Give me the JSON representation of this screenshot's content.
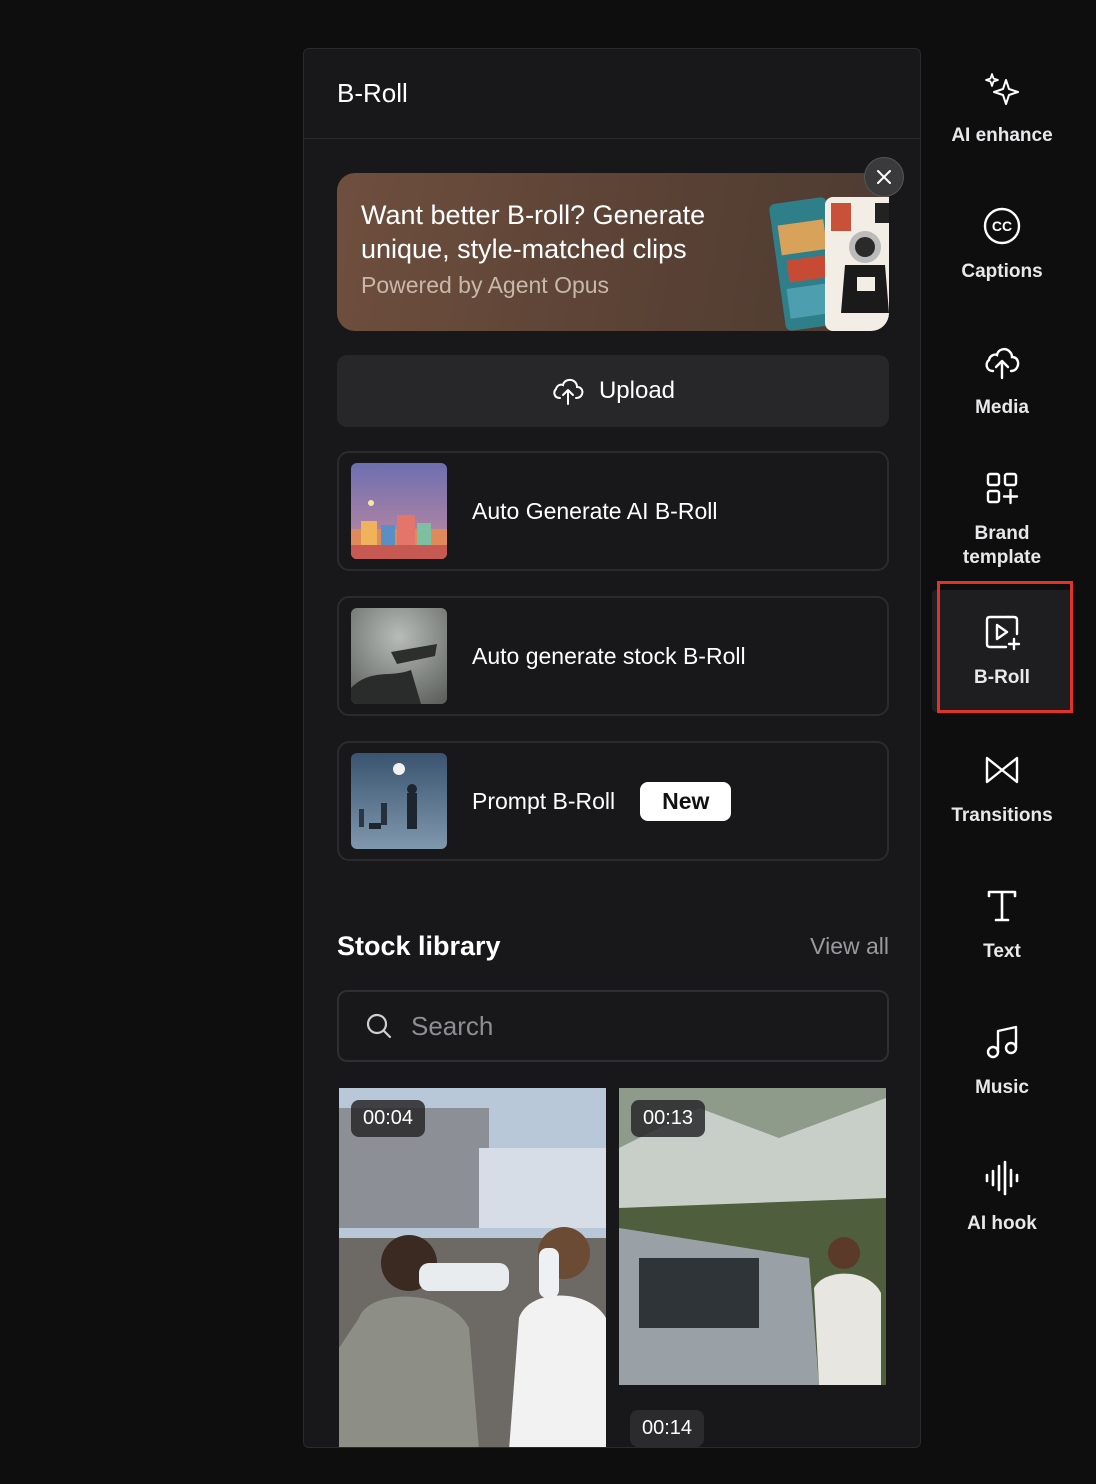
{
  "panel": {
    "title": "B-Roll"
  },
  "promo": {
    "title": "Want better B-roll? Generate unique, style-matched clips",
    "subtitle": "Powered by Agent Opus"
  },
  "upload": {
    "label": "Upload"
  },
  "options": [
    {
      "label": "Auto Generate AI B-Roll"
    },
    {
      "label": "Auto generate stock B-Roll"
    },
    {
      "label": "Prompt B-Roll",
      "badge": "New"
    }
  ],
  "stock": {
    "title": "Stock library",
    "view_all": "View all",
    "search_placeholder": "Search",
    "clips": [
      {
        "duration": "00:04"
      },
      {
        "duration": "00:13"
      },
      {
        "duration": "00:14"
      }
    ]
  },
  "sidebar": {
    "active": "B-Roll",
    "items": [
      {
        "label": "AI enhance",
        "icon": "sparkles-icon"
      },
      {
        "label": "Captions",
        "icon": "cc-icon"
      },
      {
        "label": "Media",
        "icon": "cloud-upload-icon"
      },
      {
        "label": "Brand template",
        "icon": "grid-plus-icon"
      },
      {
        "label": "B-Roll",
        "icon": "video-plus-icon"
      },
      {
        "label": "Transitions",
        "icon": "transition-icon"
      },
      {
        "label": "Text",
        "icon": "text-icon"
      },
      {
        "label": "Music",
        "icon": "music-icon"
      },
      {
        "label": "AI hook",
        "icon": "waveform-icon"
      }
    ]
  },
  "colors": {
    "background": "#0e0e0f",
    "panel": "#18181a",
    "promo": "#6f4f3e",
    "highlight": "#e0332b"
  }
}
